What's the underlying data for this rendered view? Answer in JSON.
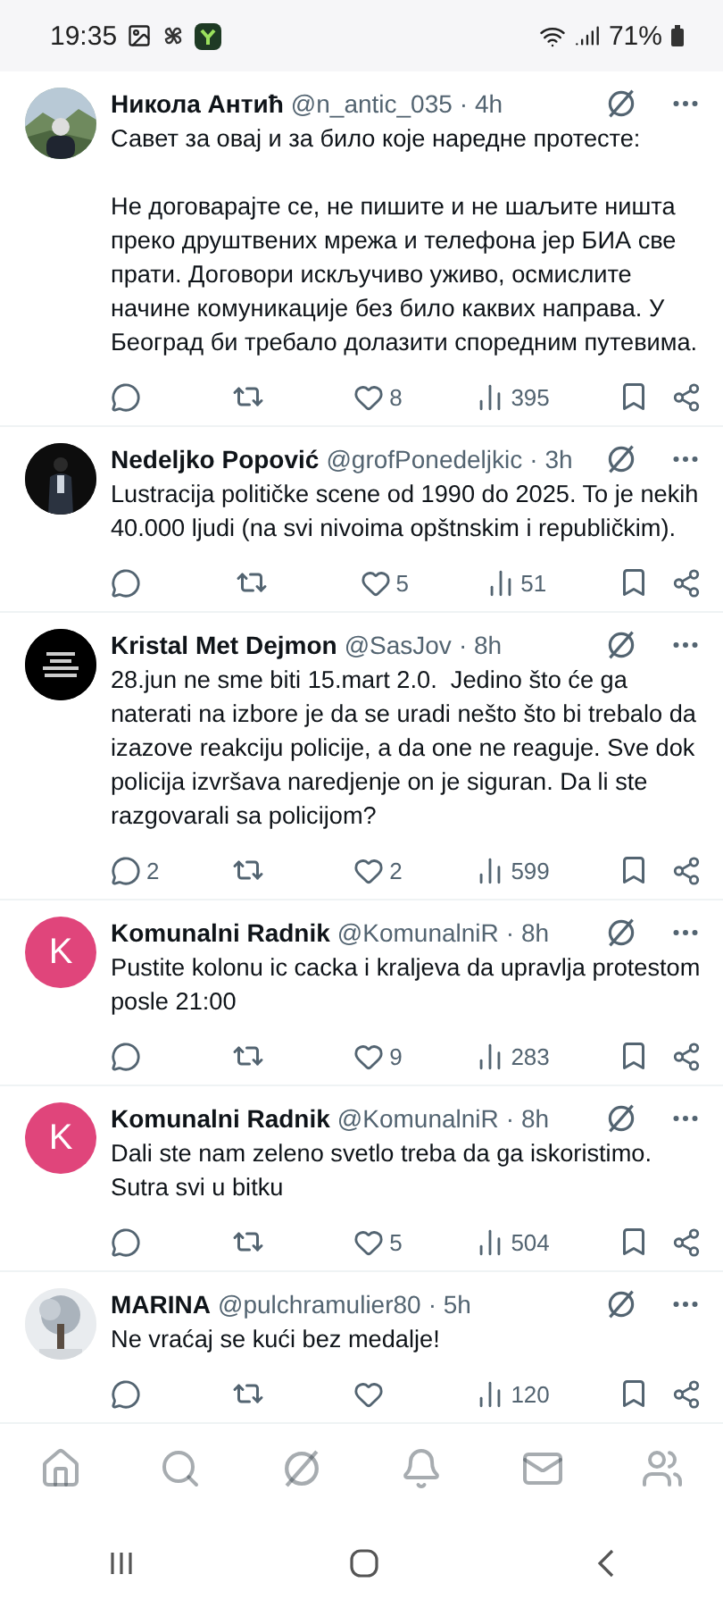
{
  "status_bar": {
    "time": "19:35",
    "battery": "71%"
  },
  "tweets": [
    {
      "name": "Никола Антић",
      "handle": "@n_antic_035",
      "time": "· 4h",
      "text": "Савет за овај и за било које наредне протесте:\n\nНе договарајте се, не пишите и не шаљите ништа преко друштвених мрежа и телефона јер БИА све прати. Договори искључиво уживо, осмислите начине комуникације без било каквих направа. У Београд би требало долазити споредним путевима.",
      "likes": "8",
      "views": "395"
    },
    {
      "avatar": {
        "kind": "dark"
      },
      "name": "Nedeljko Popović",
      "handle": "@grofPonedeljkic",
      "time": "· 3h",
      "text": "Lustracija političke scene od 1990 do 2025. To je nekih 40.000 ljudi (na svi nivoima opštnskim i republičkim).",
      "likes": "5",
      "views": "51"
    },
    {
      "avatar": {
        "kind": "black"
      },
      "name": "Kristal Met Dejmon",
      "handle": "@SasJov",
      "time": "· 8h",
      "text": "28.jun ne sme biti 15.mart 2.0.  Jedino što će ga naterati na izbore je da se uradi nešto što bi trebalo da izazove reakciju policije, a da one ne reaguje. Sve dok policija izvršava naredjenje on je siguran. Da li ste razgovarali sa policijom?",
      "replies": "2",
      "likes": "2",
      "views": "599"
    },
    {
      "avatar": {
        "kind": "letter",
        "letter": "K",
        "color": "#e0457b"
      },
      "name": "Komunalni Radnik",
      "handle": "@KomunalniR",
      "time": "· 8h",
      "text": "Pustite kolonu ic cacka i kraljeva da upravlja protestom posle 21:00",
      "likes": "9",
      "views": "283"
    },
    {
      "avatar": {
        "kind": "letter",
        "letter": "K",
        "color": "#e0457b"
      },
      "name": "Komunalni Radnik",
      "handle": "@KomunalniR",
      "time": "· 8h",
      "text": "Dali ste nam zeleno svetlo treba da ga iskoristimo. Sutra svi u bitku",
      "likes": "5",
      "views": "504"
    },
    {
      "avatar": {
        "kind": "tree"
      },
      "name": "MARINA",
      "handle": "@pulchramulier80",
      "time": "· 5h",
      "text": "Ne vraćaj se kući bez medalje!",
      "views": "120"
    }
  ],
  "bottom_nav": [
    {
      "kind": "home"
    },
    {
      "kind": "search"
    },
    {
      "kind": "grok"
    },
    {
      "kind": "notifications"
    },
    {
      "kind": "messages"
    },
    {
      "kind": "communities"
    }
  ]
}
